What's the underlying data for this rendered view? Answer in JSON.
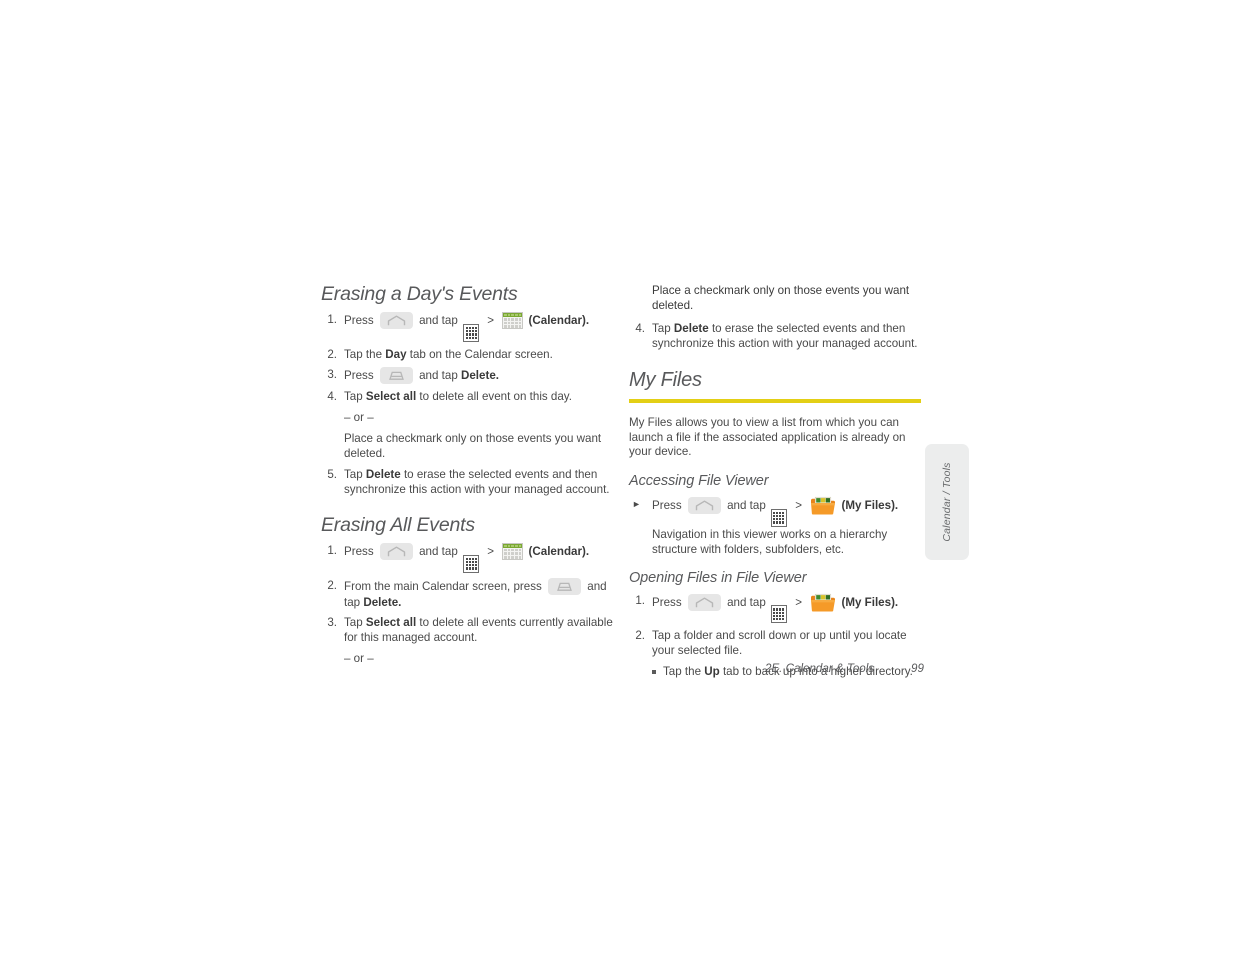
{
  "page": {
    "footer_chapter": "2E. Calendar & Tools",
    "footer_page_number": "99",
    "side_tab_label": "Calendar / Tools",
    "rule_color": "#e3cf15"
  },
  "left_column": {
    "sections": [
      {
        "heading": "Erasing a Day's Events",
        "steps": [
          {
            "num": "1.",
            "parts": [
              {
                "type": "text",
                "value": "Press "
              },
              {
                "type": "icon",
                "value": "home-key-icon"
              },
              {
                "type": "text",
                "value": " and tap "
              },
              {
                "type": "icon",
                "value": "apps-grid-icon"
              },
              {
                "type": "text",
                "value": ">"
              },
              {
                "type": "icon",
                "value": "calendar-icon"
              },
              {
                "type": "bold",
                "value": "(Calendar)."
              }
            ],
            "plain": "Press [Home] and tap [Apps] > [Calendar] (Calendar)."
          },
          {
            "num": "2.",
            "plain_prefix": "Tap the ",
            "bold": "Day",
            "plain_suffix": " tab on the Calendar screen."
          },
          {
            "num": "3.",
            "plain_prefix": "Press ",
            "icon": "menu-key-icon",
            "mid": " and tap ",
            "bold": "Delete."
          },
          {
            "num": "4.",
            "plain_prefix": "Tap ",
            "bold": "Select all",
            "plain_suffix": " to delete all event on this day.",
            "or_label": "– or –",
            "continuation": "Place a checkmark only on those events you want deleted."
          },
          {
            "num": "5.",
            "plain_prefix": "Tap ",
            "bold": "Delete",
            "plain_suffix": " to erase the selected events and then synchronize this action with your managed account."
          }
        ]
      },
      {
        "heading": "Erasing All Events",
        "steps": [
          {
            "num": "1.",
            "plain": "Press [Home] and tap [Apps] > [Calendar] (Calendar).",
            "bold": "(Calendar)."
          },
          {
            "num": "2.",
            "plain_prefix": "From the main Calendar screen, press ",
            "icon": "menu-key-icon",
            "mid": " and tap ",
            "bold": "Delete."
          },
          {
            "num": "3.",
            "plain_prefix": "Tap ",
            "bold": "Select all",
            "plain_suffix": " to delete all events currently available for this managed account.",
            "or_label": "– or –"
          }
        ]
      }
    ]
  },
  "right_column": {
    "continued_paragraph": "Place a checkmark only on those events you want deleted.",
    "continued_step": {
      "num": "4.",
      "plain_prefix": "Tap ",
      "bold": "Delete",
      "plain_suffix": " to erase the selected events and then synchronize this action with your managed account."
    },
    "my_files": {
      "heading": "My Files",
      "intro": "My Files allows you to view a list from which you can launch a file if the associated application is already on your device.",
      "subsections": [
        {
          "heading": "Accessing File Viewer",
          "bullet": {
            "marker": "►",
            "prefix": "Press ",
            "mid": " and tap ",
            "bold": "(My Files).",
            "body": "Navigation in this viewer works on a hierarchy structure with folders, subfolders, etc."
          }
        },
        {
          "heading": "Opening Files in File Viewer",
          "steps": [
            {
              "num": "1.",
              "prefix": "Press ",
              "mid": " and tap ",
              "bold": "(My Files)."
            },
            {
              "num": "2.",
              "plain": "Tap a folder and scroll down or up until you locate your selected file.",
              "substep_prefix": "Tap the ",
              "substep_bold": "Up",
              "substep_suffix": " tab to back up into a higher directory."
            }
          ]
        }
      ]
    }
  },
  "labels": {
    "press": "Press",
    "and_tap": "and tap",
    "gt": ">",
    "calendar_label": "(Calendar).",
    "my_files_label": "(My Files).",
    "or": "– or –"
  }
}
